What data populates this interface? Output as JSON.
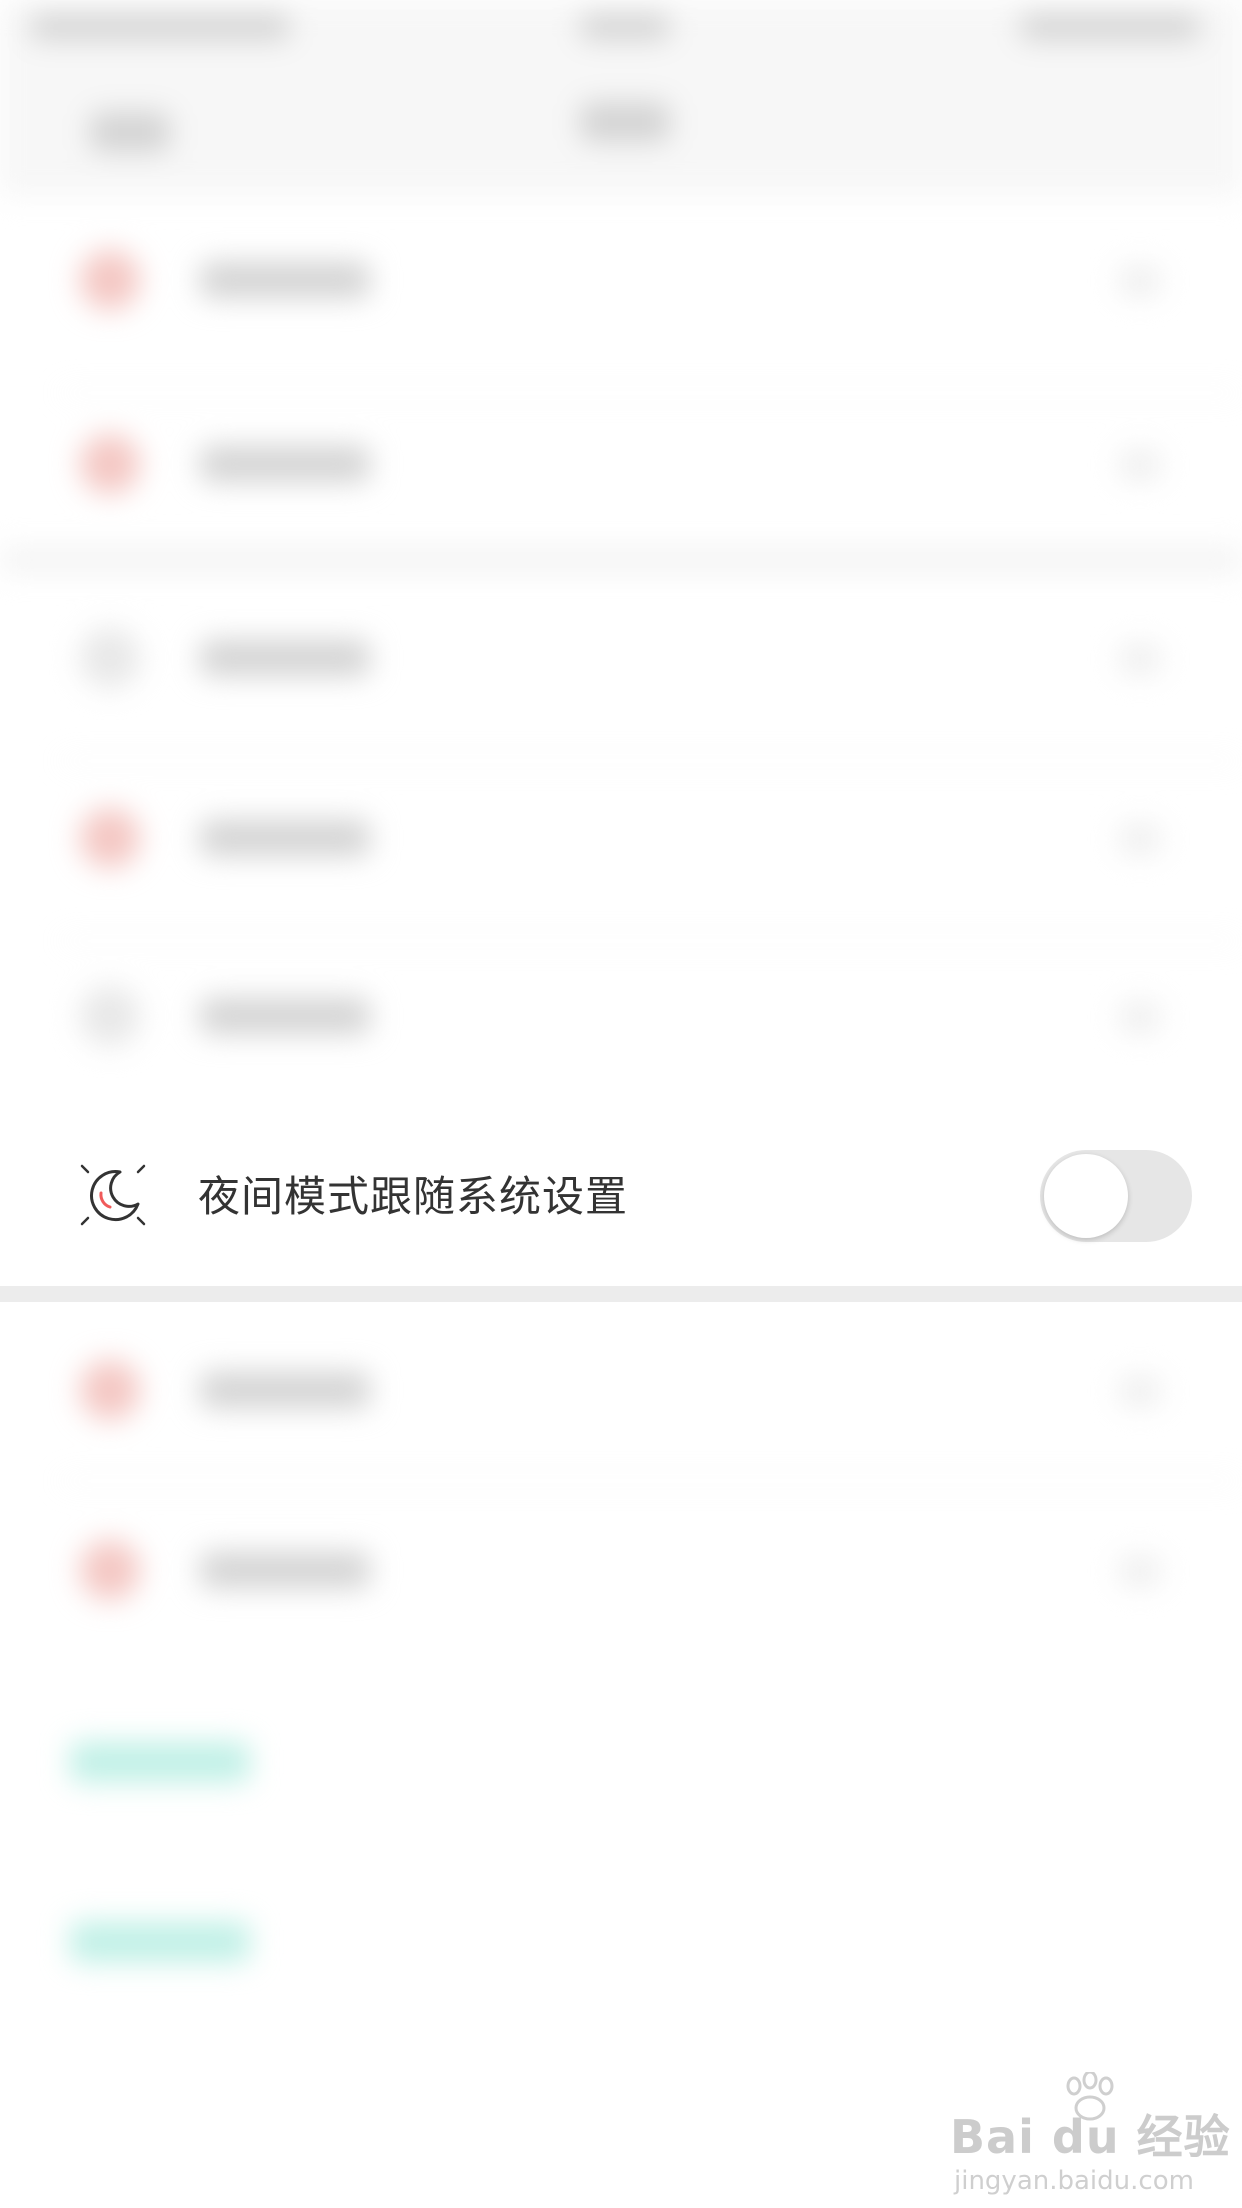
{
  "night_mode_row": {
    "label": "夜间模式跟随系统设置",
    "toggle_on": false
  },
  "watermark": {
    "logo": "Bai du 经验",
    "url": "jingyan.baidu.com"
  },
  "colors": {
    "toggle_track_off": "#e6e6e6",
    "icon_accent": "#f05a5a",
    "text_primary": "#333333"
  }
}
